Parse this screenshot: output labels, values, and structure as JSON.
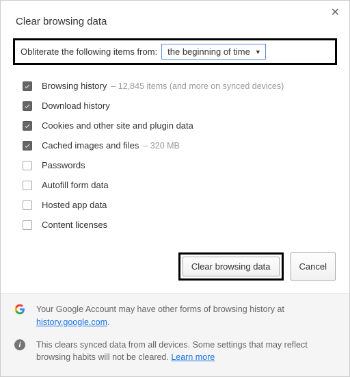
{
  "dialog": {
    "title": "Clear browsing data",
    "time_label": "Obliterate the following items from:",
    "time_selected": "the beginning of time"
  },
  "items": [
    {
      "label": "Browsing history",
      "extra": "12,845 items (and more on synced devices)",
      "checked": true
    },
    {
      "label": "Download history",
      "extra": "",
      "checked": true
    },
    {
      "label": "Cookies and other site and plugin data",
      "extra": "",
      "checked": true
    },
    {
      "label": "Cached images and files",
      "extra": "320 MB",
      "checked": true
    },
    {
      "label": "Passwords",
      "extra": "",
      "checked": false
    },
    {
      "label": "Autofill form data",
      "extra": "",
      "checked": false
    },
    {
      "label": "Hosted app data",
      "extra": "",
      "checked": false
    },
    {
      "label": "Content licenses",
      "extra": "",
      "checked": false
    }
  ],
  "buttons": {
    "primary": "Clear browsing data",
    "cancel": "Cancel"
  },
  "footer": {
    "google_text_pre": "Your Google Account may have other forms of browsing history at ",
    "google_link": "history.google.com",
    "google_text_post": ".",
    "info_text_pre": "This clears synced data from all devices. Some settings that may reflect browsing habits will not be cleared. ",
    "info_link": "Learn more"
  }
}
